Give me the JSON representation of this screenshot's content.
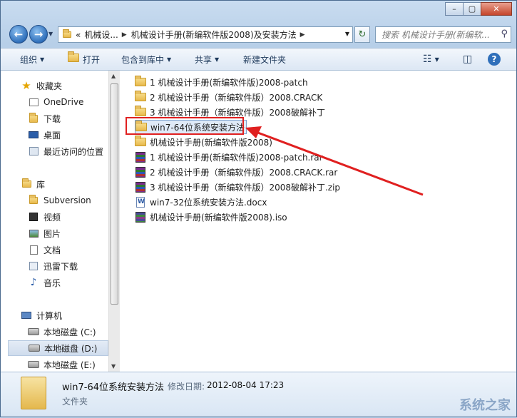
{
  "window": {
    "caption_buttons": [
      "–",
      "▢",
      "✕"
    ]
  },
  "nav": {
    "back": "←",
    "forward": "→",
    "address_crumbs": [
      "«",
      "机械设...",
      "机械设计手册(新编软件版2008)及安装方法"
    ],
    "search_placeholder": "搜索 机械设计手册(新编软..."
  },
  "toolbar": {
    "organize": "组织",
    "open": "打开",
    "include_library": "包含到库中",
    "share": "共享",
    "new_folder": "新建文件夹"
  },
  "sidebar": {
    "favorites": {
      "title": "收藏夹",
      "items": [
        "OneDrive",
        "下载",
        "桌面",
        "最近访问的位置"
      ]
    },
    "libraries": {
      "title": "库",
      "items": [
        "Subversion",
        "视频",
        "图片",
        "文档",
        "迅雷下载",
        "音乐"
      ]
    },
    "computer": {
      "title": "计算机",
      "items": [
        "本地磁盘 (C:)",
        "本地磁盘 (D:)",
        "本地磁盘 (E:)"
      ]
    }
  },
  "files": [
    {
      "name": "1 机械设计手册(新编软件版)2008-patch",
      "type": "folder"
    },
    {
      "name": "2 机械设计手册（新编软件版）2008.CRACK",
      "type": "folder"
    },
    {
      "name": "3 机械设计手册（新编软件版）2008破解补丁",
      "type": "folder"
    },
    {
      "name": "win7-64位系统安装方法",
      "type": "folder"
    },
    {
      "name": "机械设计手册(新编软件版2008)",
      "type": "folder"
    },
    {
      "name": "1 机械设计手册(新编软件版)2008-patch.rar",
      "type": "rar"
    },
    {
      "name": "2 机械设计手册（新编软件版）2008.CRACK.rar",
      "type": "rar"
    },
    {
      "name": "3 机械设计手册（新编软件版）2008破解补丁.zip",
      "type": "rar"
    },
    {
      "name": "win7-32位系统安装方法.docx",
      "type": "docx"
    },
    {
      "name": "机械设计手册(新编软件版2008).iso",
      "type": "iso"
    }
  ],
  "details": {
    "name": "win7-64位系统安装方法",
    "modified_label": "修改日期:",
    "modified_value": "2012-08-04 17:23",
    "type": "文件夹"
  },
  "watermark": "系统之家",
  "colors": {
    "highlight_box": "#e02020",
    "selection": "#dfeaf8"
  }
}
